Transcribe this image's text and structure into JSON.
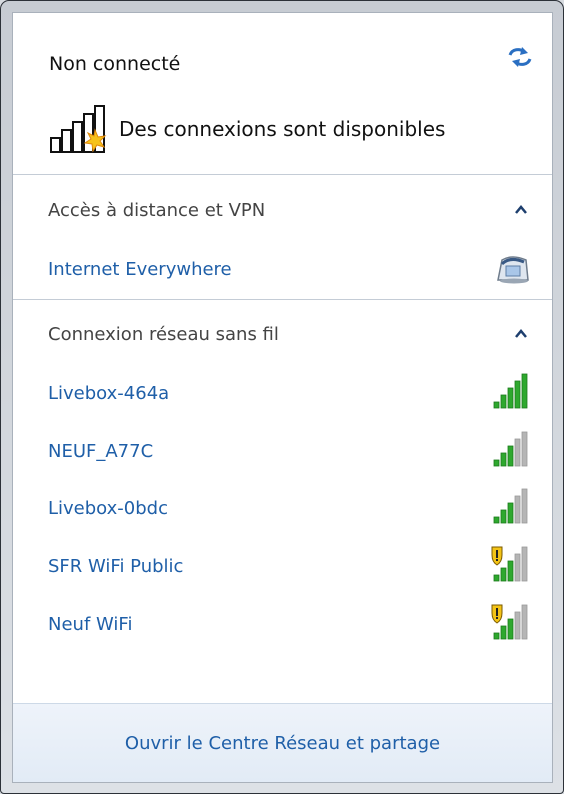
{
  "header": {
    "status": "Non connecté",
    "refresh_icon": "refresh-arrows-icon",
    "availability": "Des connexions sont disponibles"
  },
  "sections": [
    {
      "title": "Accès à distance et VPN",
      "items": [
        {
          "label": "Internet Everywhere",
          "icon": "dialup-modem-icon"
        }
      ]
    },
    {
      "title": "Connexion réseau sans fil",
      "items": [
        {
          "label": "Livebox-464a",
          "icon": "signal-strength-icon",
          "bars": 5,
          "secured_warning": false
        },
        {
          "label": "NEUF_A77C",
          "icon": "signal-strength-icon",
          "bars": 3,
          "secured_warning": false
        },
        {
          "label": "Livebox-0bdc",
          "icon": "signal-strength-icon",
          "bars": 3,
          "secured_warning": false
        },
        {
          "label": "SFR WiFi Public",
          "icon": "signal-strength-shield-icon",
          "bars": 3,
          "secured_warning": true
        },
        {
          "label": "Neuf WiFi",
          "icon": "signal-strength-shield-icon",
          "bars": 3,
          "secured_warning": true
        }
      ]
    }
  ],
  "footer": {
    "link": "Ouvrir le Centre Réseau et partage"
  },
  "colors": {
    "link": "#1f5fa8",
    "signal_active": "#2ea82e",
    "signal_inactive": "#b5b5b5"
  }
}
